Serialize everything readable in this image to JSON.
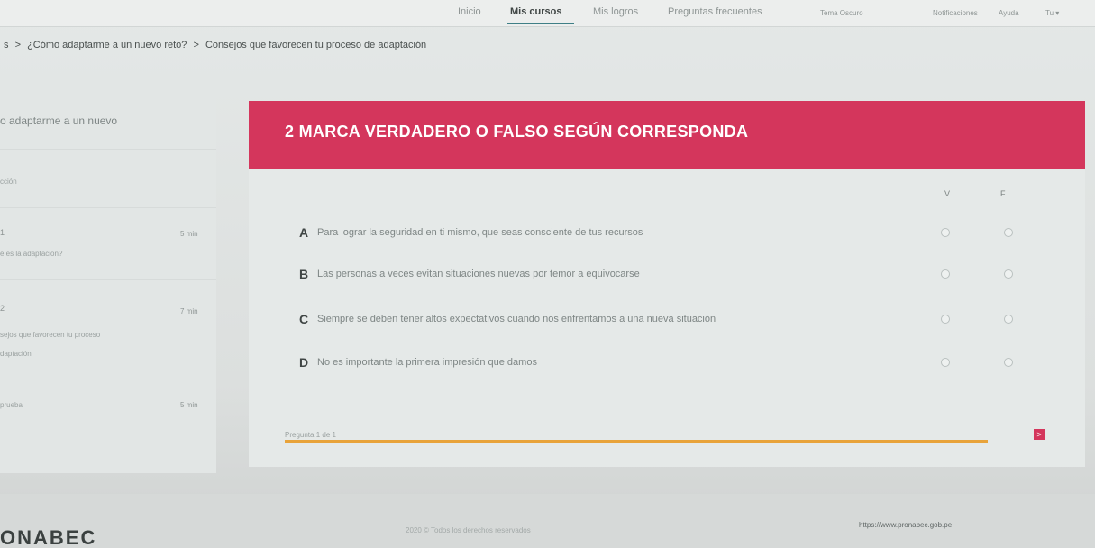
{
  "nav": {
    "items": [
      {
        "label": "Inicio",
        "active": false
      },
      {
        "label": "Mis cursos",
        "active": true
      },
      {
        "label": "Mis logros",
        "active": false
      },
      {
        "label": "Preguntas frecuentes",
        "active": false
      }
    ],
    "secure_label": "Tema Oscuro",
    "notifications_label": "Notificaciones",
    "help_label": "Ayuda",
    "user_label": "Tu ▾"
  },
  "breadcrumb": {
    "items": [
      "s",
      "¿Cómo adaptarme a un nuevo reto?",
      "Consejos que favorecen tu proceso de adaptación"
    ],
    "separator": ">"
  },
  "sidebar": {
    "title": "o adaptarme a un nuevo",
    "section_label": "cción",
    "lessons": [
      {
        "num": "1",
        "time": "5 min",
        "text": "é es la adaptación?"
      },
      {
        "num": "2",
        "time": "7 min",
        "text": "sejos que favorecen tu proceso",
        "text2": "daptación"
      },
      {
        "num": "",
        "time": "5 min",
        "text": "prueba"
      }
    ]
  },
  "quiz": {
    "title": "2  MARCA VERDADERO O FALSO SEGÚN CORRESPONDA",
    "col_true": "V",
    "col_false": "F",
    "questions": [
      {
        "letter": "A",
        "text": "Para lograr la seguridad en ti mismo, que seas consciente de tus recursos"
      },
      {
        "letter": "B",
        "text": "Las personas a veces evitan situaciones nuevas por temor a equivocarse"
      },
      {
        "letter": "C",
        "text": "Siempre se deben tener altos expectativos cuando nos enfrentamos a una nueva situación"
      },
      {
        "letter": "D",
        "text": "No es importante la primera impresión que damos"
      }
    ],
    "counter": "Pregunta 1 de 1",
    "next_label": ">"
  },
  "footer": {
    "brand": "ONABEC",
    "copyright": "2020 © Todos los derechos reservados",
    "url": "https://www.pronabec.gob.pe"
  },
  "colors": {
    "accent": "#d4365c",
    "progress": "#e8a33a",
    "nav_active": "#3f7f86"
  }
}
